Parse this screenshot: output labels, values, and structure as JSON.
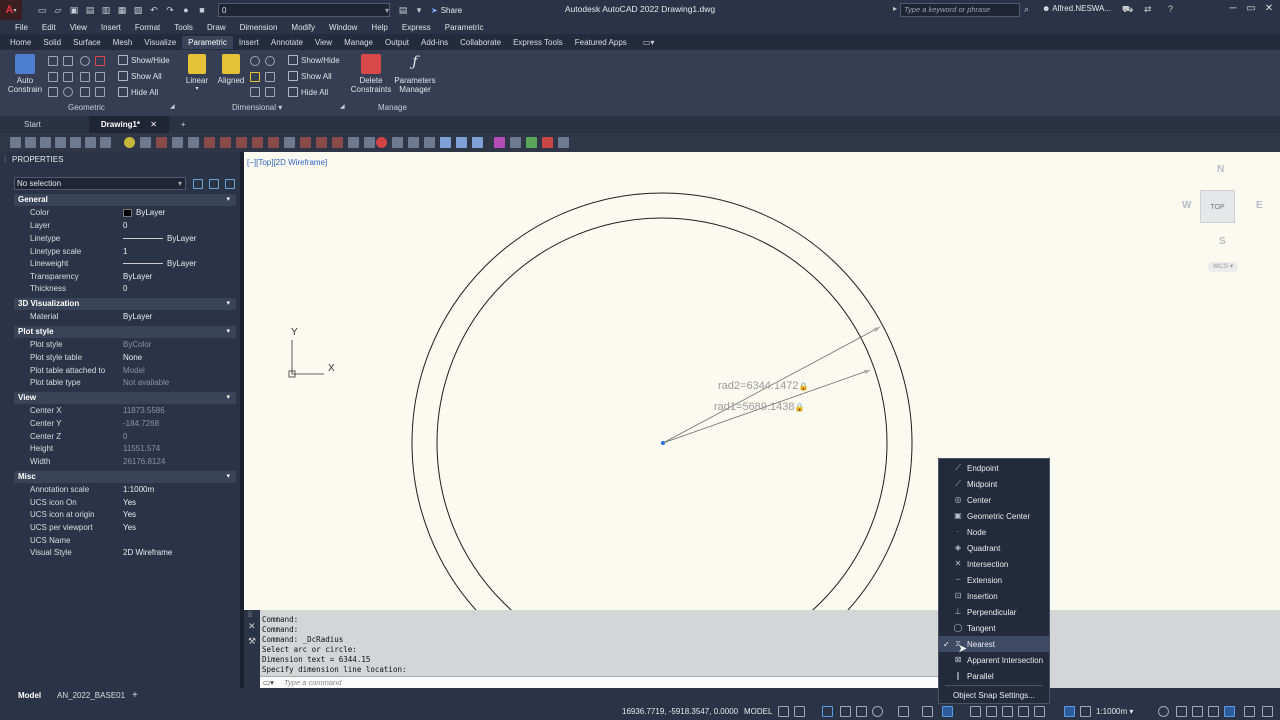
{
  "titlebar": {
    "app_letter": "A",
    "app_menu_arrow": "▾",
    "workspace_value": "0",
    "share_label": "Share",
    "title": "Autodesk AutoCAD 2022    Drawing1.dwg",
    "search_placeholder": "Type a keyword or phrase",
    "user": "Alfred.NESWA...",
    "minimize": "─",
    "restore": "▭",
    "close": "✕"
  },
  "menubar": [
    "File",
    "Edit",
    "View",
    "Insert",
    "Format",
    "Tools",
    "Draw",
    "Dimension",
    "Modify",
    "Window",
    "Help",
    "Express",
    "Parametric"
  ],
  "ribbon_tabs": [
    "Home",
    "Solid",
    "Surface",
    "Mesh",
    "Visualize",
    "Parametric",
    "Insert",
    "Annotate",
    "View",
    "Manage",
    "Output",
    "Add-ins",
    "Collaborate",
    "Express Tools",
    "Featured Apps"
  ],
  "ribbon_active_tab": "Parametric",
  "ribbon": {
    "auto_constrain": "Auto Constrain",
    "auto_constrain_1": "Auto",
    "auto_constrain_2": "Constrain",
    "geo_show_hide": "Show/Hide",
    "geo_show_all": "Show All",
    "geo_hide_all": "Hide All",
    "geometric_label": "Geometric",
    "linear": "Linear",
    "aligned": "Aligned",
    "dim_show_hide": "Show/Hide",
    "dim_show_all": "Show All",
    "dim_hide_all": "Hide All",
    "dimensional_label": "Dimensional",
    "delete_constraints_1": "Delete",
    "delete_constraints_2": "Constraints",
    "params_manager_1": "Parameters",
    "params_manager_2": "Manager",
    "manage_label": "Manage"
  },
  "file_tabs": [
    "Start",
    "Drawing1*"
  ],
  "file_tab_add": "+",
  "properties": {
    "title": "PROPERTIES",
    "selection": "No selection",
    "sections": [
      {
        "name": "General",
        "rows": [
          [
            "Color",
            "ByLayer"
          ],
          [
            "Layer",
            "0"
          ],
          [
            "Linetype",
            "ByLayer"
          ],
          [
            "Linetype scale",
            "1"
          ],
          [
            "Lineweight",
            "ByLayer"
          ],
          [
            "Transparency",
            "ByLayer"
          ],
          [
            "Thickness",
            "0"
          ]
        ]
      },
      {
        "name": "3D Visualization",
        "rows": [
          [
            "Material",
            "ByLayer"
          ]
        ]
      },
      {
        "name": "Plot style",
        "rows": [
          [
            "Plot style",
            "ByColor"
          ],
          [
            "Plot style table",
            "None"
          ],
          [
            "Plot table attached to",
            "Model"
          ],
          [
            "Plot table type",
            "Not available"
          ]
        ]
      },
      {
        "name": "View",
        "rows": [
          [
            "Center X",
            "11873.5586"
          ],
          [
            "Center Y",
            "-184.7268"
          ],
          [
            "Center Z",
            "0"
          ],
          [
            "Height",
            "11551.574"
          ],
          [
            "Width",
            "26176.8124"
          ]
        ]
      },
      {
        "name": "Misc",
        "rows": [
          [
            "Annotation scale",
            "1:1000m"
          ],
          [
            "UCS icon On",
            "Yes"
          ],
          [
            "UCS icon at origin",
            "Yes"
          ],
          [
            "UCS per viewport",
            "Yes"
          ],
          [
            "UCS Name",
            ""
          ],
          [
            "Visual Style",
            "2D Wireframe"
          ]
        ]
      }
    ]
  },
  "viewport": {
    "label": "[−][Top][2D Wireframe]",
    "rad2": "rad2=6344.1472",
    "rad1": "rad1=5689.1438",
    "ucs_x": "X",
    "ucs_y": "Y",
    "viewcube": {
      "n": "N",
      "s": "S",
      "e": "E",
      "w": "W",
      "top": "TOP",
      "wcs": "WCS"
    }
  },
  "command": {
    "history": [
      "Command:",
      "Command:",
      "Command: _DcRadius",
      "Select arc or circle:",
      "Dimension text = 6344.15",
      "Specify dimension line location:"
    ],
    "placeholder": "Type a command"
  },
  "snap_menu": {
    "items": [
      "Endpoint",
      "Midpoint",
      "Center",
      "Geometric Center",
      "Node",
      "Quadrant",
      "Intersection",
      "Extension",
      "Insertion",
      "Perpendicular",
      "Tangent",
      "Nearest",
      "Apparent Intersection",
      "Parallel"
    ],
    "checked": "Nearest",
    "settings": "Object Snap Settings..."
  },
  "status": {
    "layout_tabs": [
      "Model",
      "AN_2022_BASE01"
    ],
    "add_tab": "+",
    "coords": "16936.7719, -5918.3547, 0.0000",
    "model": "MODEL",
    "scale": "1:1000m"
  },
  "colors": {
    "accent": "#2e64c0",
    "background": "#fbfaf1",
    "panel": "#2b3346"
  }
}
